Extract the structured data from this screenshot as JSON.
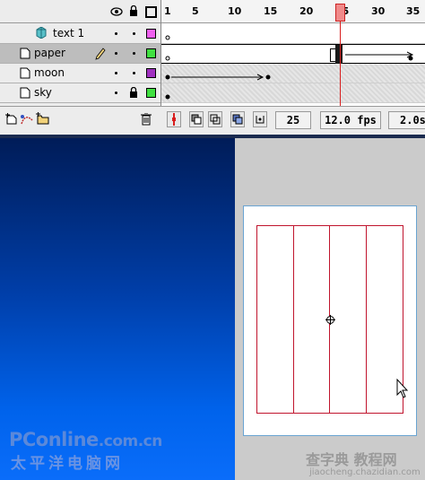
{
  "timeline": {
    "ruler_numbers": [
      "1",
      "5",
      "10",
      "15",
      "20",
      "25",
      "30",
      "35"
    ],
    "current_frame": "25",
    "fps": "12.0 fps",
    "elapsed": "2.0s",
    "layers": [
      {
        "name": "text 1",
        "color": "#f060f0",
        "locked": false,
        "selected": false
      },
      {
        "name": "paper",
        "color": "#40e040",
        "locked": false,
        "selected": true
      },
      {
        "name": "moon",
        "color": "#a030c0",
        "locked": false,
        "selected": false
      },
      {
        "name": "sky",
        "color": "#40e040",
        "locked": true,
        "selected": false
      }
    ]
  },
  "watermarks": {
    "pconline": "PConline",
    "pconline_suffix": ".com.cn",
    "pconline_cn": "太平洋电脑网",
    "jiaocheng_cn": "查字典 教程网",
    "jiaocheng_url": "jiaocheng.chazidian.com"
  },
  "colors": {
    "playhead": "#d81e1e",
    "paper_outline": "#c0142d",
    "sky_top": "#001c58",
    "sky_bottom": "#0a6dfa"
  }
}
